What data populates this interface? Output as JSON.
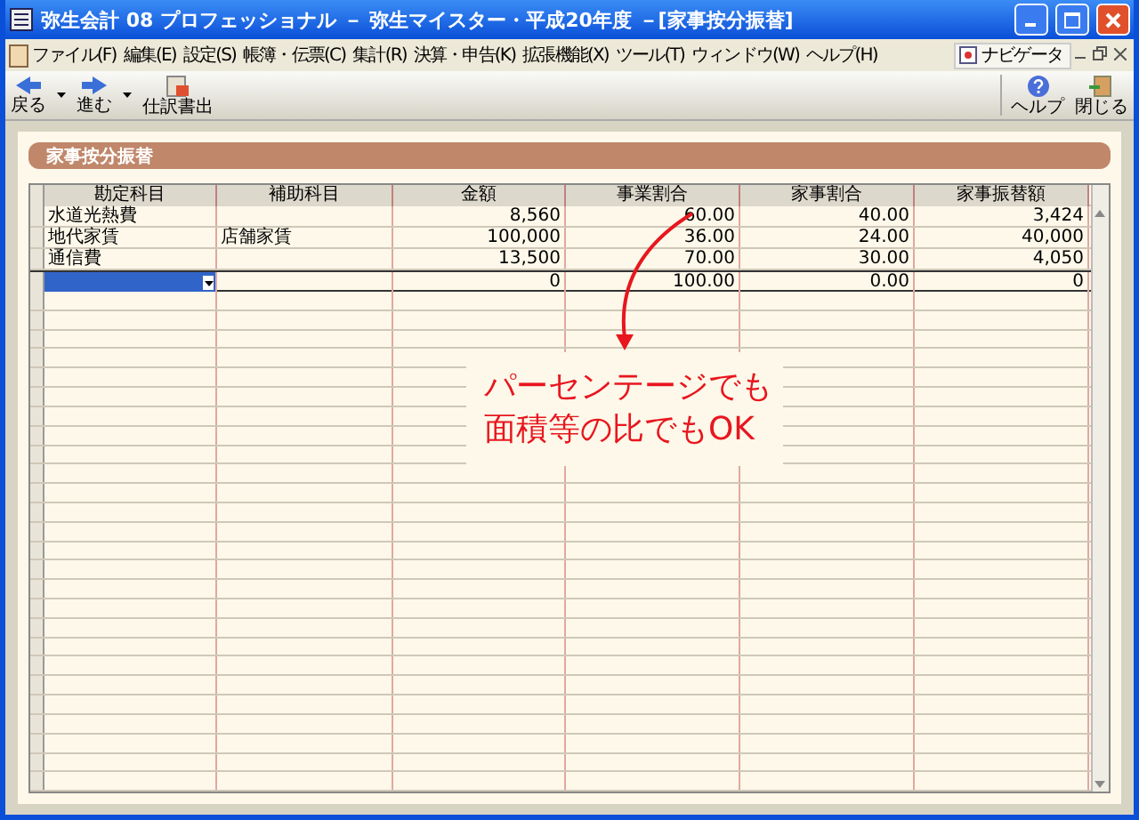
{
  "window": {
    "title": "弥生会計 08 プロフェッショナル － 弥生マイスター・平成20年度 －[家事按分振替]"
  },
  "menu": [
    "ファイル(F)",
    "編集(E)",
    "設定(S)",
    "帳簿・伝票(C)",
    "集計(R)",
    "決算・申告(K)",
    "拡張機能(X)",
    "ツール(T)",
    "ウィンドウ(W)",
    "ヘルプ(H)"
  ],
  "navigator": "ナビゲータ",
  "toolbar_left": [
    {
      "label": "戻る",
      "kind": "back",
      "dropdown": true
    },
    {
      "label": "進む",
      "kind": "forward",
      "dropdown": true
    },
    {
      "label": "仕訳書出",
      "kind": "export",
      "dropdown": false
    }
  ],
  "toolbar_right": [
    {
      "label": "ヘルプ",
      "kind": "help"
    },
    {
      "label": "閉じる",
      "kind": "close"
    }
  ],
  "panel_title": "家事按分振替",
  "table": {
    "columns": [
      "勘定科目",
      "補助科目",
      "金額",
      "事業割合",
      "家事割合",
      "家事振替額"
    ],
    "rows": [
      {
        "selected": false,
        "cells": [
          "水道光熱費",
          "",
          "8,560",
          "60.00",
          "40.00",
          "3,424"
        ]
      },
      {
        "selected": false,
        "cells": [
          "地代家賃",
          "店舗家賃",
          "100,000",
          "36.00",
          "24.00",
          "40,000"
        ]
      },
      {
        "selected": false,
        "cells": [
          "通信費",
          "",
          "13,500",
          "70.00",
          "30.00",
          "4,050"
        ]
      },
      {
        "selected": true,
        "cells": [
          "",
          "",
          "0",
          "100.00",
          "0.00",
          "0"
        ]
      }
    ]
  },
  "annotation": {
    "lines": [
      "パーセンテージでも",
      "面積等の比でもOK"
    ]
  }
}
